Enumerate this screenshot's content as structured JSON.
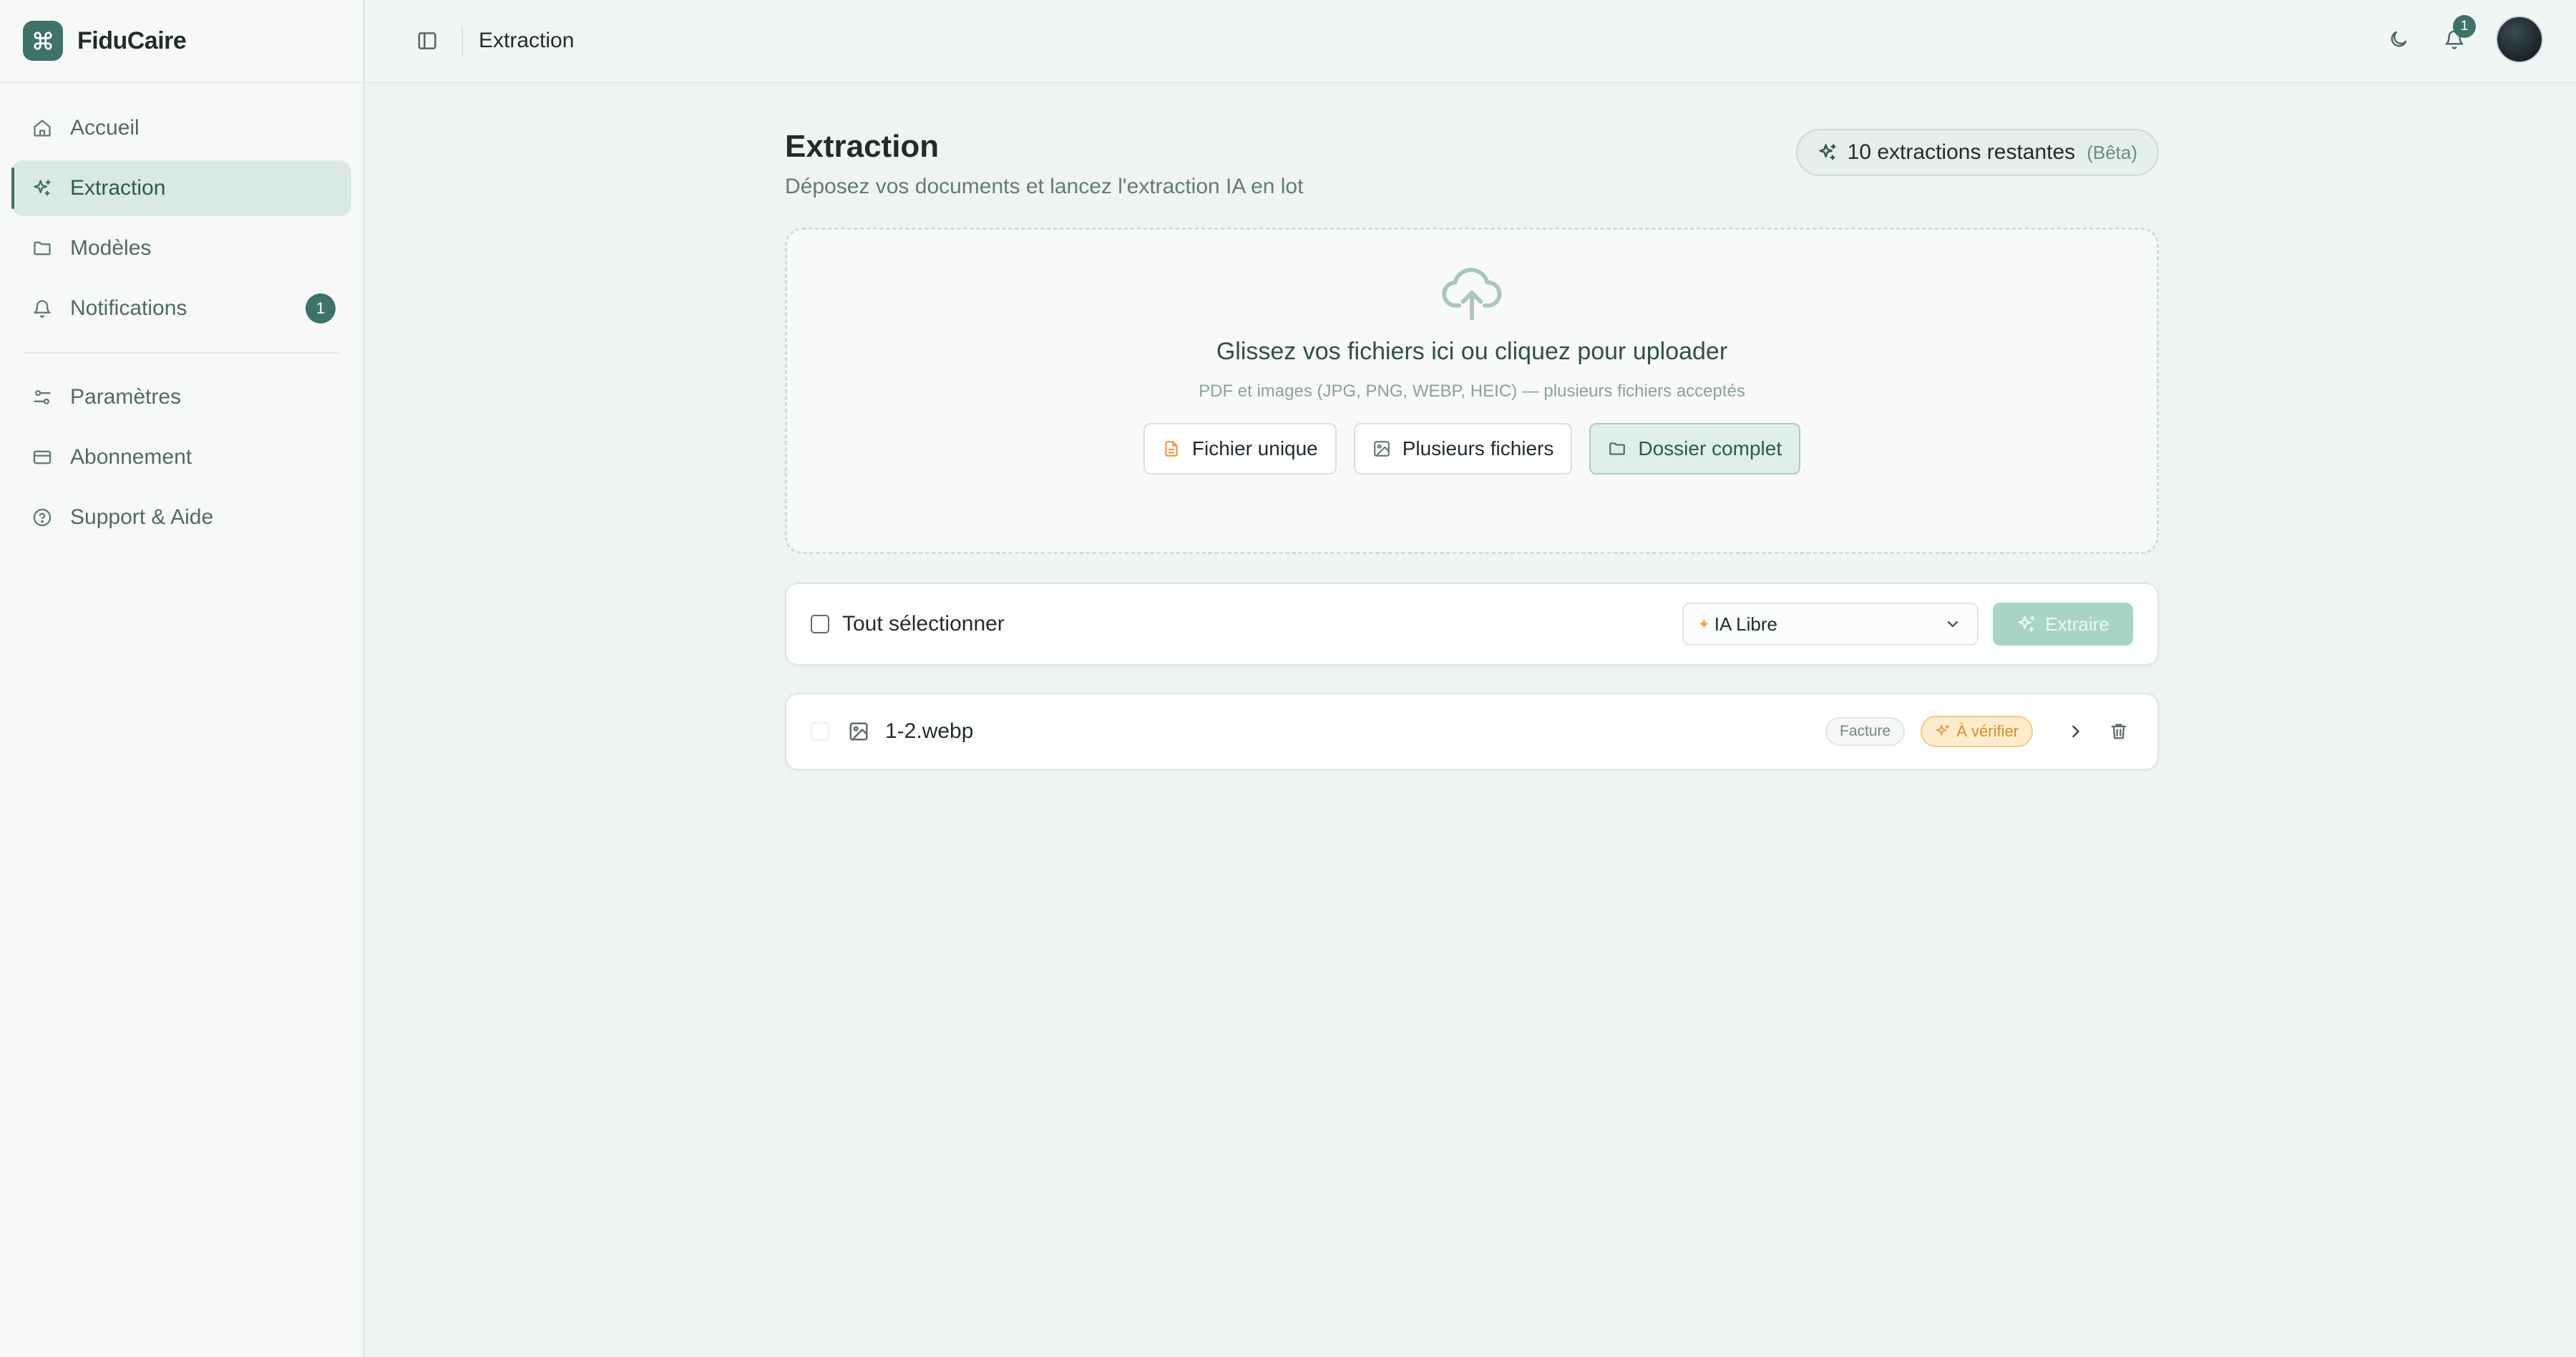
{
  "app": {
    "name": "FiduCaire",
    "accent": "#3f7268"
  },
  "sidebar": {
    "items": [
      {
        "label": "Accueil",
        "icon": "home-icon"
      },
      {
        "label": "Extraction",
        "icon": "sparkles-icon",
        "active": true
      },
      {
        "label": "Modèles",
        "icon": "folder-icon"
      },
      {
        "label": "Notifications",
        "icon": "bell-icon",
        "badge": "1"
      },
      {
        "label": "Paramètres",
        "icon": "sliders-icon"
      },
      {
        "label": "Abonnement",
        "icon": "credit-card-icon"
      },
      {
        "label": "Support & Aide",
        "icon": "help-circle-icon"
      }
    ]
  },
  "topbar": {
    "title": "Extraction",
    "notification_count": "1"
  },
  "page": {
    "title": "Extraction",
    "subtitle": "Déposez vos documents et lancez l'extraction IA en lot",
    "quota": {
      "label": "10 extractions restantes",
      "tag": "(Bêta)"
    }
  },
  "dropzone": {
    "title": "Glissez vos fichiers ici ou cliquez pour uploader",
    "subtitle": "PDF et images (JPG, PNG, WEBP, HEIC) — plusieurs fichiers acceptés",
    "buttons": {
      "single": "Fichier unique",
      "multiple": "Plusieurs fichiers",
      "folder": "Dossier complet"
    }
  },
  "toolbar": {
    "select_all": "Tout sélectionner",
    "mode": "IA Libre",
    "extract": "Extraire"
  },
  "files": [
    {
      "name": "1-2.webp",
      "type": "Facture",
      "status": "À vérifier",
      "status_color": "#d98c2a"
    }
  ]
}
